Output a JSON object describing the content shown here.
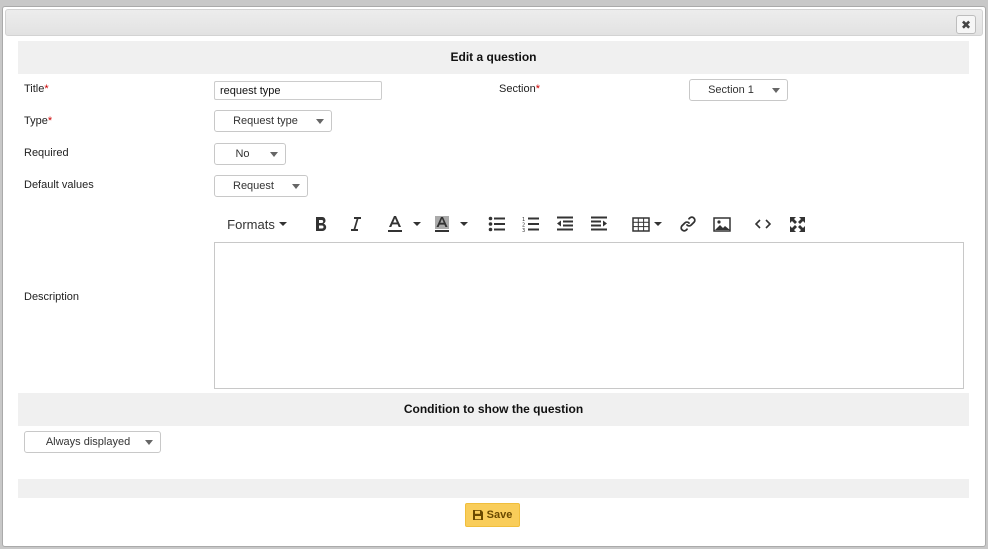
{
  "dialog": {
    "close_label": "✖",
    "header_title": "Edit a question",
    "condition_title": "Condition to show the question"
  },
  "form": {
    "title_label": "Title",
    "title_value": "request type",
    "section_label": "Section",
    "section_value": "Section 1",
    "type_label": "Type",
    "type_value": "Request type",
    "required_label": "Required",
    "required_value": "No",
    "default_label": "Default values",
    "default_value": "Request",
    "description_label": "Description",
    "required_marker": "*"
  },
  "editor": {
    "formats_label": "Formats",
    "icons": [
      "bold-icon",
      "italic-icon",
      "text-color-icon",
      "background-color-icon",
      "bullet-list-icon",
      "numbered-list-icon",
      "outdent-icon",
      "indent-icon",
      "table-icon",
      "link-icon",
      "image-icon",
      "source-code-icon",
      "fullscreen-icon"
    ]
  },
  "condition": {
    "value": "Always displayed"
  },
  "footer": {
    "save_label": "Save"
  },
  "colors": {
    "required_marker": "#cc0000",
    "save_button": "#f9cd5a",
    "section_header_bg": "#f0f0f0"
  }
}
